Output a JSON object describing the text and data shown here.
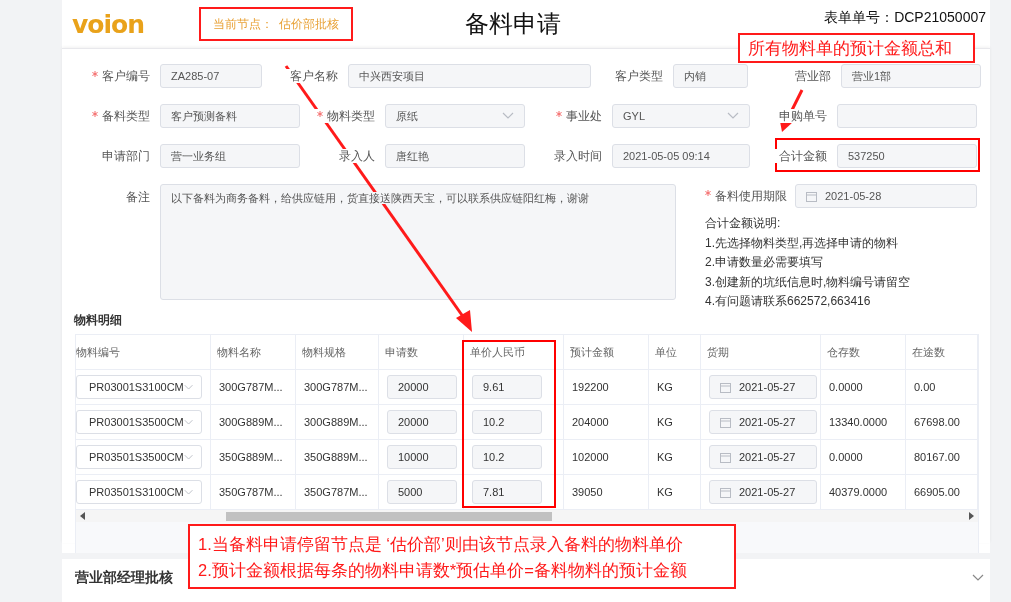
{
  "header": {
    "logo": "voion",
    "node_label": "当前节点：",
    "node_value": "估价部批核",
    "title": "备料申请",
    "form_no": "表单单号：DCP21050007"
  },
  "form_rows": [
    [
      {
        "label": "客户编号",
        "required": true,
        "kind": "input",
        "value": "ZA285-07"
      },
      {
        "label": "客户名称",
        "required": false,
        "kind": "input",
        "value": "中兴西安项目"
      },
      {
        "label": "客户类型",
        "required": false,
        "kind": "input",
        "value": "内销"
      },
      {
        "label": "营业部",
        "required": false,
        "kind": "input",
        "value": "营业1部"
      }
    ],
    [
      {
        "label": "备料类型",
        "required": true,
        "kind": "input",
        "value": "客户预测备料"
      },
      {
        "label": "物料类型",
        "required": true,
        "kind": "select",
        "value": "原纸"
      },
      {
        "label": "事业处",
        "required": true,
        "kind": "select",
        "value": "GYL"
      },
      {
        "label": "申购单号",
        "required": false,
        "kind": "input"
      }
    ],
    [
      {
        "label": "申请部门",
        "required": false,
        "kind": "input",
        "value": "营一业务组"
      },
      {
        "label": "录入人",
        "required": false,
        "kind": "input",
        "value": "唐红艳"
      },
      {
        "label": "录入时间",
        "required": false,
        "kind": "input",
        "value": "2021-05-05 09:14"
      },
      {
        "label": "合计金额",
        "required": false,
        "kind": "input",
        "value": "537250"
      }
    ]
  ],
  "remark": {
    "label": "备注",
    "value": "以下备料为商务备料，给供应链用，货直接送陕西天宝，可以联系供应链阳红梅，谢谢"
  },
  "deadline": {
    "label": "备料使用期限",
    "required": true,
    "value": "2021-05-28"
  },
  "notes": {
    "title": "合计金额说明:",
    "lines": [
      "1.先选择物料类型,再选择申请的物料",
      "2.申请数量必需要填写",
      "3.创建新的坑纸信息时,物料编号请留空",
      "4.有问题请联系662572,663416"
    ]
  },
  "materials": {
    "title": "物料明细",
    "columns": [
      {
        "label": "物料编号",
        "kind": "select"
      },
      {
        "label": "物料名称",
        "kind": "text"
      },
      {
        "label": "物料规格",
        "kind": "text"
      },
      {
        "label": "申请数",
        "kind": "input"
      },
      {
        "label": "单价人民币",
        "kind": "input"
      },
      {
        "label": "预计金额",
        "kind": "text"
      },
      {
        "label": "单位",
        "kind": "text"
      },
      {
        "label": "货期",
        "kind": "date"
      },
      {
        "label": "仓存数",
        "kind": "text"
      },
      {
        "label": "在途数",
        "kind": "text"
      }
    ],
    "rows": [
      [
        "PR03001S3100CM",
        "300G787M...",
        "300G787M...",
        "20000",
        "9.61",
        "192200",
        "KG",
        "2021-05-27",
        "0.0000",
        "0.00"
      ],
      [
        "PR03001S3500CM",
        "300G889M...",
        "300G889M...",
        "20000",
        "10.2",
        "204000",
        "KG",
        "2021-05-27",
        "13340.0000",
        "67698.00"
      ],
      [
        "PR03501S3500CM",
        "350G889M...",
        "350G889M...",
        "10000",
        "10.2",
        "102000",
        "KG",
        "2021-05-27",
        "0.0000",
        "80167.00"
      ],
      [
        "PR03501S3100CM",
        "350G787M...",
        "350G787M...",
        "5000",
        "7.81",
        "39050",
        "KG",
        "2021-05-27",
        "40379.0000",
        "66905.00"
      ]
    ]
  },
  "section": {
    "title": "营业部经理批核",
    "expanded": false
  },
  "annotations": [
    {
      "kind": "callout",
      "lines": [
        "所有物料单的预计金额总和"
      ]
    },
    {
      "kind": "callout",
      "lines": [
        "1.当备料申请停留节点是 ‘估价部’则由该节点录入备料的物料单价",
        "2.预计金额根据每条的物料申请数*预估单价=备料物料的预计金额"
      ]
    }
  ]
}
